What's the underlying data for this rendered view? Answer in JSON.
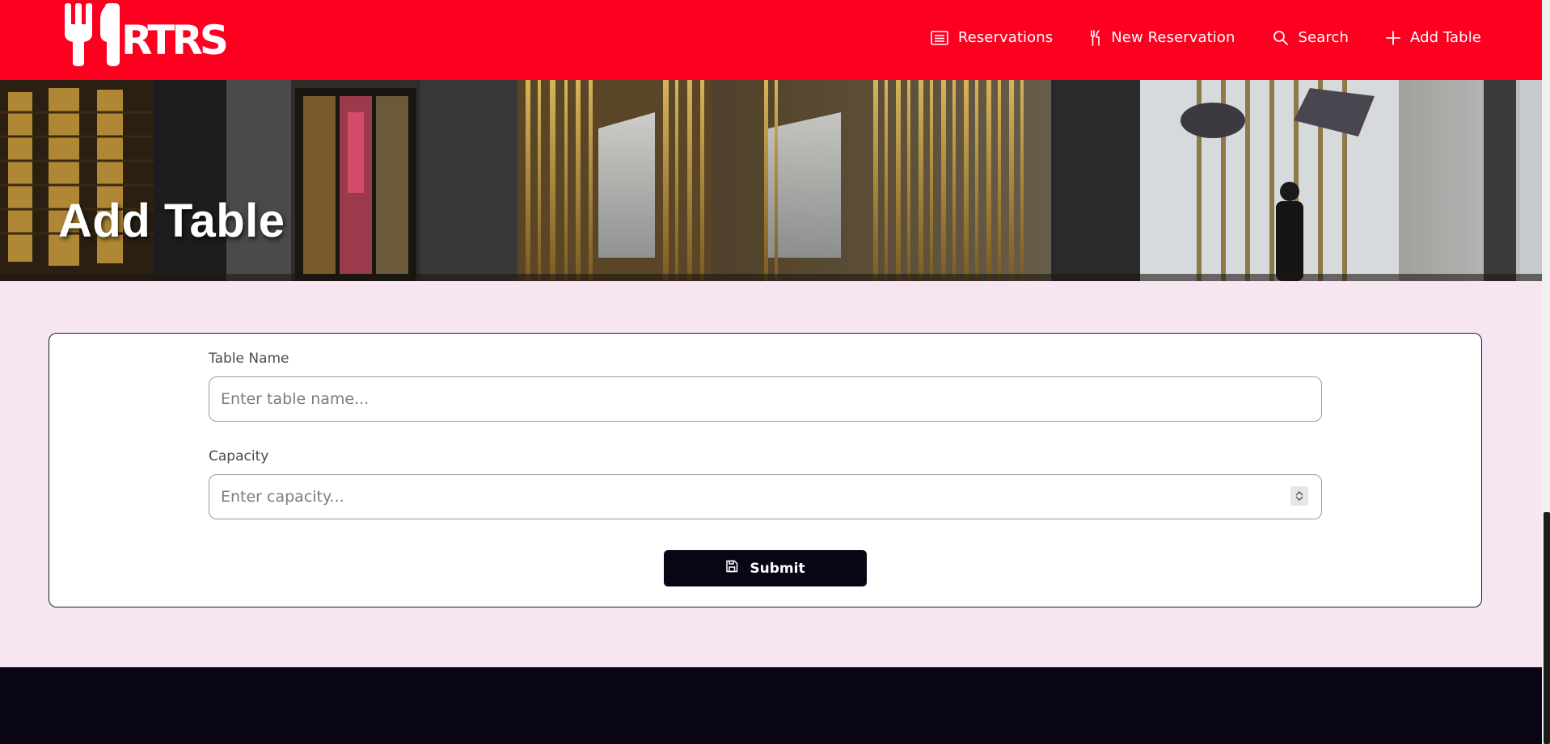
{
  "brand": {
    "logo_text": "RTRS",
    "header_color": "#fd0020"
  },
  "nav": {
    "items": [
      {
        "label": "Reservations",
        "icon": "list-icon"
      },
      {
        "label": "New Reservation",
        "icon": "fork-knife-icon"
      },
      {
        "label": "Search",
        "icon": "search-icon"
      },
      {
        "label": "Add Table",
        "icon": "plus-icon"
      }
    ]
  },
  "hero": {
    "title": "Add Table"
  },
  "form": {
    "table_name": {
      "label": "Table Name",
      "placeholder": "Enter table name...",
      "value": ""
    },
    "capacity": {
      "label": "Capacity",
      "placeholder": "Enter capacity...",
      "value": ""
    },
    "submit": {
      "label": "Submit",
      "icon": "save-icon"
    }
  },
  "colors": {
    "content_bg": "#f7e6f2",
    "dark": "#0a0514"
  }
}
